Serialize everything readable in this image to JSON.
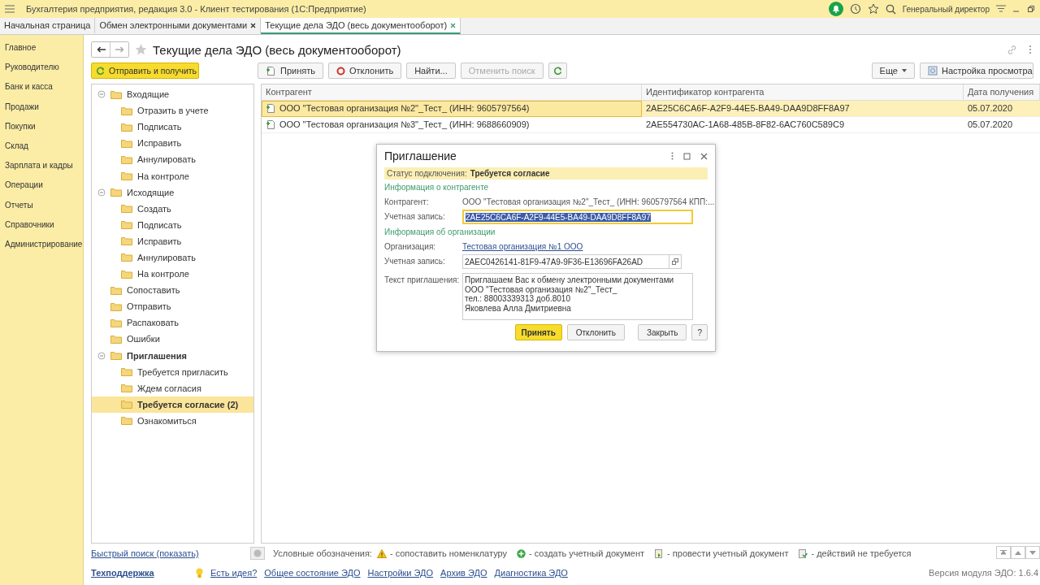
{
  "window": {
    "title": "Бухгалтерия предприятия, редакция 3.0  - Клиент тестирования (1С:Предприятие)",
    "user": "Генеральный директор"
  },
  "tabs": [
    {
      "label": "Начальная страница",
      "selected": false,
      "closable": false
    },
    {
      "label": "Обмен электронными документами",
      "selected": false,
      "closable": true
    },
    {
      "label": "Текущие дела ЭДО (весь документооборот)",
      "selected": true,
      "closable": true
    }
  ],
  "sections": [
    "Главное",
    "Руководителю",
    "Банк и касса",
    "Продажи",
    "Покупки",
    "Склад",
    "Зарплата и кадры",
    "Операции",
    "Отчеты",
    "Справочники",
    "Администрирование"
  ],
  "page": {
    "title": "Текущие дела ЭДО (весь документооборот)",
    "toolbar": [
      {
        "kind": "primary",
        "label": "Отправить и получить",
        "disabled": false
      },
      {
        "kind": "accept",
        "label": "Принять",
        "disabled": false
      },
      {
        "kind": "decline",
        "label": "Отклонить",
        "disabled": false
      },
      {
        "kind": "plain",
        "label": "Найти...",
        "disabled": false
      },
      {
        "kind": "plain",
        "label": "Отменить поиск",
        "disabled": true
      },
      {
        "kind": "refresh"
      },
      {
        "kind": "more",
        "label": "Еще",
        "disabled": false
      },
      {
        "kind": "settings",
        "label": "Настройка просмотра",
        "disabled": false
      }
    ]
  },
  "tree": [
    {
      "label": "Входящие",
      "expanded": true,
      "selected": false,
      "children": [
        {
          "label": "Отразить в учете",
          "selected": false
        },
        {
          "label": "Подписать",
          "selected": false
        },
        {
          "label": "Исправить",
          "selected": false
        },
        {
          "label": "Аннулировать",
          "selected": false
        },
        {
          "label": "На контроле",
          "selected": false
        }
      ]
    },
    {
      "label": "Исходящие",
      "expanded": true,
      "selected": false,
      "children": [
        {
          "label": "Создать",
          "selected": false
        },
        {
          "label": "Подписать",
          "selected": false
        },
        {
          "label": "Исправить",
          "selected": false
        },
        {
          "label": "Аннулировать",
          "selected": false
        },
        {
          "label": "На контроле",
          "selected": false
        }
      ]
    },
    {
      "label": "Сопоставить",
      "selected": false
    },
    {
      "label": "Отправить",
      "selected": false
    },
    {
      "label": "Распаковать",
      "selected": false
    },
    {
      "label": "Ошибки",
      "selected": false
    },
    {
      "label": "Приглашения",
      "expanded": true,
      "selected": false,
      "children": [
        {
          "label": "Требуется пригласить",
          "selected": false
        },
        {
          "label": "Ждем согласия",
          "selected": false
        },
        {
          "label": "Требуется согласие (2)",
          "selected": true
        },
        {
          "label": "Ознакомиться",
          "selected": false
        }
      ]
    }
  ],
  "table": {
    "columns": [
      "Контрагент",
      "Идентификатор контрагента",
      "Дата получения"
    ],
    "rows": [
      {
        "cells": [
          "ООО \"Тестовая организация №2\"_Тест_ (ИНН: 9605797564)",
          "2AE25C6CA6F-A2F9-44E5-BA49-DAA9D8FF8A97",
          "05.07.2020"
        ],
        "selected": true
      },
      {
        "cells": [
          "ООО \"Тестовая организация №3\"_Тест_ (ИНН: 9688660909)",
          "2AE554730AC-1A68-485B-8F82-6AC760C589C9",
          "05.07.2020"
        ],
        "selected": false
      }
    ]
  },
  "dialog": {
    "title": "Приглашение",
    "status_label": "Статус подключения:",
    "status_value": "Требуется согласие",
    "groups": [
      {
        "heading": "Информация о контрагенте",
        "fields": [
          {
            "kind": "text",
            "label": "Контрагент:",
            "value": "ООО \"Тестовая организация №2\"_Тест_ (ИНН: 9605797564 КПП:..."
          },
          {
            "kind": "input",
            "label": "Учетная запись:",
            "value": "2AE25C6CA6F-A2F9-44E5-BA49-DAA9D8FF8A97",
            "focused": true
          }
        ]
      },
      {
        "heading": "Информация об организации",
        "fields": [
          {
            "kind": "link",
            "label": "Организация:",
            "value": "Тестовая организация №1 ООО"
          },
          {
            "kind": "select",
            "label": "Учетная запись:",
            "value": "2AEC0426141-81F9-47A9-9F36-E13696FA26AD",
            "focused": false
          },
          {
            "kind": "textarea",
            "label": "Текст приглашения:",
            "value": "Приглашаем Вас к обмену электронными документами\nООО \"Тестовая организация №2\"_Тест_\nтел.: 88003339313 доб.8010\nЯковлева Алла Дмитриевна"
          }
        ]
      }
    ],
    "buttons": [
      {
        "label": "Принять",
        "default": true
      },
      {
        "label": "Отклонить",
        "default": false
      },
      {
        "label": "Закрыть",
        "default": false
      },
      {
        "label": "?",
        "default": false
      }
    ]
  },
  "footer": {
    "quick_search": "Быстрый поиск (показать)",
    "support": "Техподдержка",
    "idea": "Есть идея?",
    "links": [
      "Общее состояние ЭДО",
      "Настройки ЭДО",
      "Архив ЭДО",
      "Диагностика ЭДО"
    ],
    "legend_label": "Условные обозначения:",
    "legend": [
      {
        "kind": "warning",
        "text": "- сопоставить номенклатуру"
      },
      {
        "kind": "create",
        "text": "- создать учетный документ"
      },
      {
        "kind": "post",
        "text": "- провести учетный документ"
      },
      {
        "kind": "none",
        "text": "- действий не требуется"
      }
    ],
    "version": "Версия модуля ЭДО: 1.6.4"
  }
}
